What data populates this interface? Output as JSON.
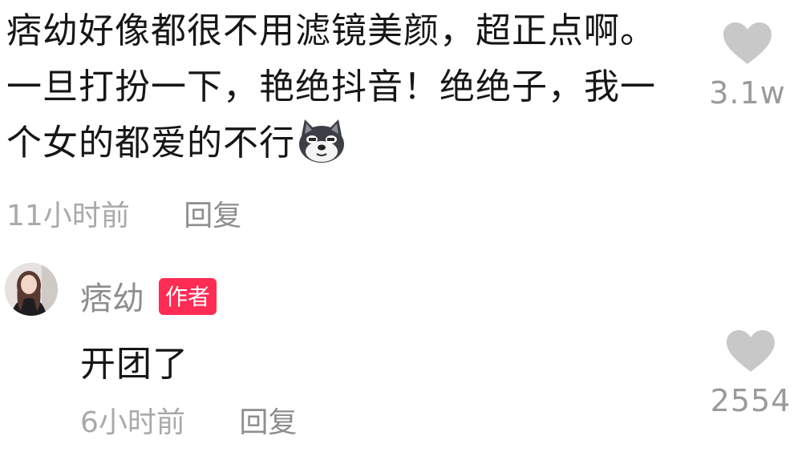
{
  "comment": {
    "text": "痞幼好像都很不用滤镜美颜，超正点啊。一旦打扮一下，艳绝抖音！绝绝子，我一个女的都爱的不行",
    "emoji": "wolf-emoji",
    "time": "11小时前",
    "reply_label": "回复",
    "likes": "3.1w"
  },
  "author_reply": {
    "username": "痞幼",
    "badge": "作者",
    "text": "开团了",
    "time": "6小时前",
    "reply_label": "回复",
    "likes": "2554"
  },
  "colors": {
    "badge": "#fe2c55",
    "heart": "#c8c8c8",
    "meta": "#a9a9a9"
  }
}
